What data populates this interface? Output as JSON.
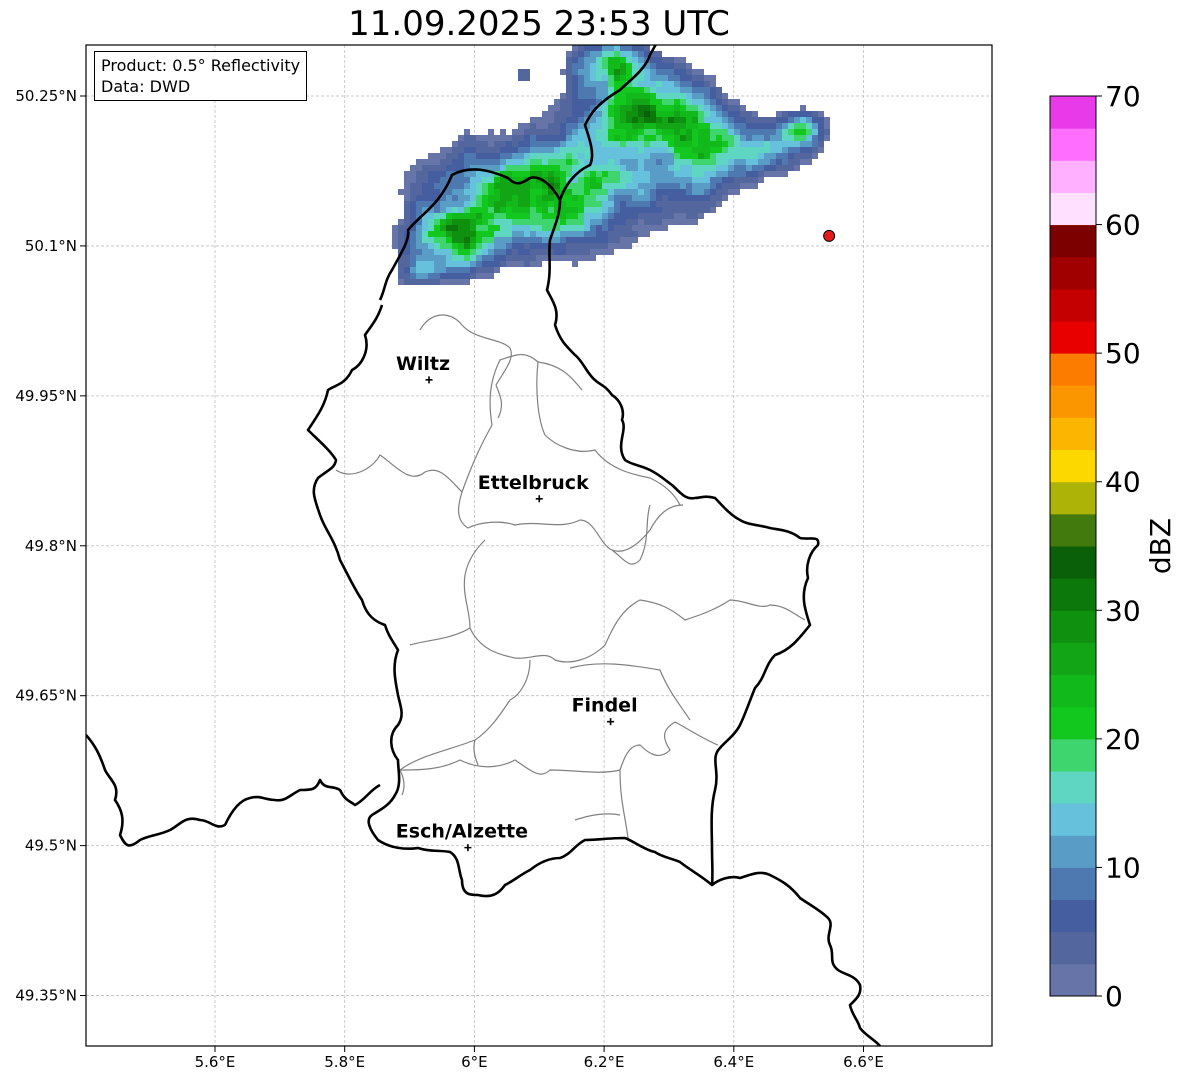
{
  "title": "11.09.2025 23:53 UTC",
  "info": {
    "product": "Product: 0.5° Reflectivity",
    "data": "Data: DWD"
  },
  "axes": {
    "lon_ticks": [
      "5.6°E",
      "5.8°E",
      "6°E",
      "6.2°E",
      "6.4°E",
      "6.6°E"
    ],
    "lat_ticks": [
      "50.25°N",
      "50.1°N",
      "49.95°N",
      "49.8°N",
      "49.65°N",
      "49.5°N",
      "49.35°N"
    ]
  },
  "cities": [
    {
      "name": "Wiltz",
      "lon": 5.93,
      "lat": 49.966
    },
    {
      "name": "Ettelbruck",
      "lon": 6.1,
      "lat": 49.847
    },
    {
      "name": "Findel",
      "lon": 6.21,
      "lat": 49.624
    },
    {
      "name": "Esch/Alzette",
      "lon": 5.99,
      "lat": 49.498
    }
  ],
  "radar_marker": {
    "lon": 6.547,
    "lat": 50.11,
    "color": "#e41a1c"
  },
  "colorbar": {
    "label": "dBZ",
    "min": 0,
    "max": 70,
    "step": 2.5,
    "tick_labels": [
      "0",
      "10",
      "20",
      "30",
      "40",
      "50",
      "60",
      "70"
    ],
    "colors": [
      "#6674a8",
      "#53679e",
      "#445e9f",
      "#4d79b0",
      "#599cc6",
      "#66c1dc",
      "#5fd6c2",
      "#3ed56f",
      "#12c71d",
      "#12b91b",
      "#12a516",
      "#10900f",
      "#0c780c",
      "#096008",
      "#427a0d",
      "#aeb407",
      "#fcd800",
      "#fcb500",
      "#fc9600",
      "#fc7c00",
      "#e80000",
      "#c40000",
      "#a00000",
      "#7c0000",
      "#ffe1ff",
      "#ffb0ff",
      "#ff6eff",
      "#e83ae8"
    ]
  },
  "colors": {
    "border": "#000000",
    "canton": "#808080",
    "grid": "#bfbfbf"
  }
}
